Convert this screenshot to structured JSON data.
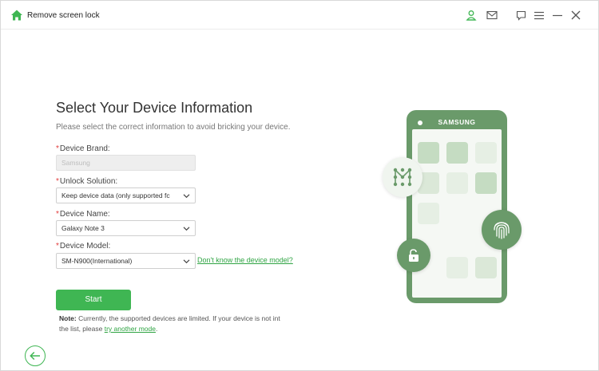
{
  "app": {
    "title": "Remove screen lock"
  },
  "titlebar_icons": [
    "user-icon",
    "mail-icon",
    "feedback-icon",
    "menu-icon",
    "minimize-icon",
    "close-icon"
  ],
  "form": {
    "title": "Select Your Device Information",
    "subtitle": "Please select the correct information to avoid bricking your device.",
    "required_mark": "*",
    "brand_label": "Device Brand:",
    "brand_value": "Samsung",
    "solution_label": "Unlock Solution:",
    "solution_value": "Keep device data (only supported fc",
    "name_label": "Device Name:",
    "name_value": "Galaxy Note 3",
    "model_label": "Device Model:",
    "model_value": "SM-N900(International)",
    "model_help_link": "Don't know the device model?"
  },
  "start_label": "Start",
  "note": {
    "prefix": "Note:",
    "text": " Currently, the supported devices are limited. If your device is not int the list, please ",
    "link": "try another mode",
    "suffix": "."
  },
  "illustration": {
    "brand_text": "SAMSUNG",
    "colors": {
      "phone": "#6a9a6a",
      "accent": "#3fb653",
      "tile_dark": "#c5dcc2",
      "tile_light": "#e6efe4"
    }
  }
}
